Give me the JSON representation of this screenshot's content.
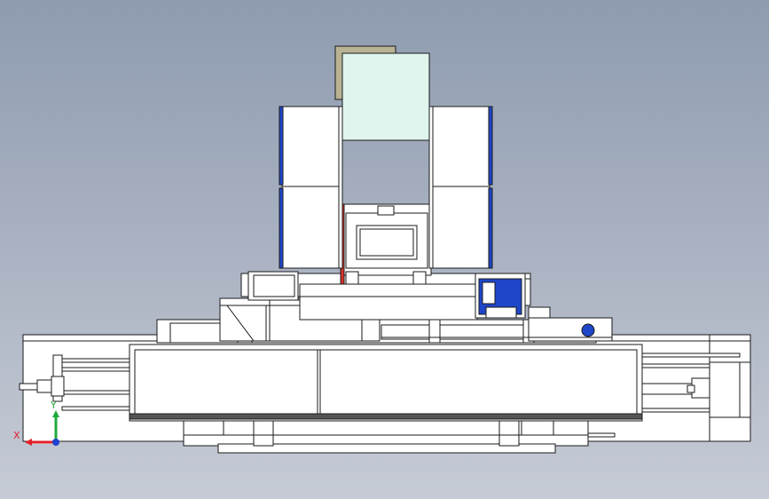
{
  "viewport": {
    "name": "cad-front-view",
    "background_top": "#8e9bb0",
    "background_bottom": "#c6cbd5"
  },
  "triad": {
    "x_label": "X",
    "y_label": "Y",
    "x_color": "#e0202a",
    "y_color": "#1faa3c",
    "z_color": "#2040d0"
  },
  "colors": {
    "part_fill": "#ffffff",
    "outline": "#1a1a1a",
    "glass": "#dff5ee",
    "blue": "#1f46c8",
    "red": "#d8322a",
    "olive": "#b9b394",
    "shadow": "#555555"
  }
}
